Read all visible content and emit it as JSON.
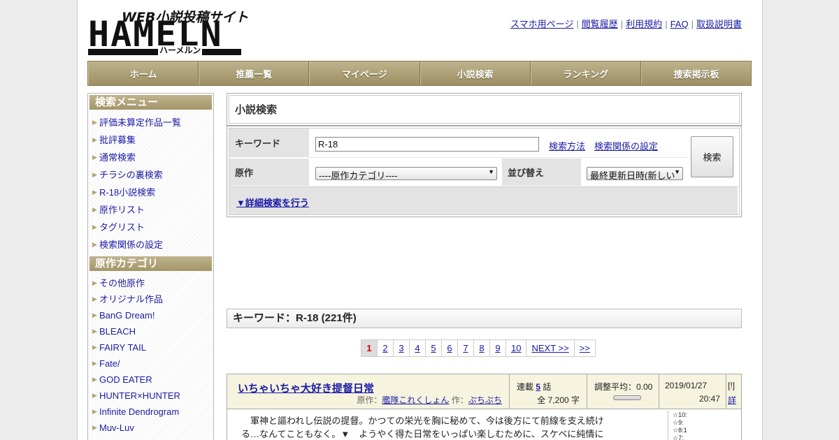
{
  "logo": {
    "sub": "WEB小説投稿サイト",
    "main": "HAMELN",
    "kana": "ハーメルン"
  },
  "toplinks": [
    "スマホ用ページ",
    "閲覧履歴",
    "利用規約",
    "FAQ",
    "取扱説明書"
  ],
  "nav": [
    "ホーム",
    "推薦一覧",
    "マイページ",
    "小説検索",
    "ランキング",
    "捜索掲示板"
  ],
  "sidebar": {
    "menu_heading": "検索メニュー",
    "menu_items": [
      "評価未算定作品一覧",
      "批評募集",
      "通常検索",
      "チラシの裏検索",
      "R-18小説検索",
      "原作リスト",
      "タグリスト",
      "検索関係の設定"
    ],
    "category_heading": "原作カテゴリ",
    "category_items": [
      "その他原作",
      "オリジナル作品",
      "BanG Dream!",
      "BLEACH",
      "FAIRY TAIL",
      "Fate/",
      "GOD EATER",
      "HUNTER×HUNTER",
      "Infinite Dendrogram",
      "Muv-Luv"
    ]
  },
  "search": {
    "title": "小説検索",
    "keyword_label": "キーワード",
    "keyword_value": "R-18",
    "how_link": "検索方法",
    "settings_link": "検索関係の設定",
    "origin_label": "原作",
    "origin_select": "----原作カテゴリ----",
    "sort_label": "並び替え",
    "sort_select": "最終更新日時(新しい",
    "search_button": "検索",
    "detail_link": "▼詳細検索を行う"
  },
  "results": {
    "heading": "キーワード：R-18 (221件)",
    "pages": [
      "1",
      "2",
      "3",
      "4",
      "5",
      "6",
      "7",
      "8",
      "9",
      "10",
      "NEXT >>",
      ">>"
    ],
    "current_page": "1"
  },
  "entry": {
    "title": "いちゃいちゃ大好き提督日常",
    "origin_prefix": "原作：",
    "origin": "艦隊これくしょん",
    "author_prefix": "作：",
    "author": "ぷちぷち",
    "serial_prefix": "連載",
    "episodes": "5",
    "episodes_suffix": "話",
    "chars": "全 7,200 字",
    "score": "調整平均：0.00",
    "date": "2019/01/27",
    "time": "20:47",
    "flag": "[!]",
    "detail": "詳",
    "desc_line1": "軍神と謳われし伝説の提督。かつての栄光を胸に秘めて、今は後方にて前線を支え続け",
    "desc_line2": "る…なんてこともなく。▼　ようやく得た日常をいっぱい楽しむために、スケベに純情に",
    "stars": [
      "☆10:",
      "☆9:",
      "☆8:1",
      "☆7:"
    ]
  }
}
